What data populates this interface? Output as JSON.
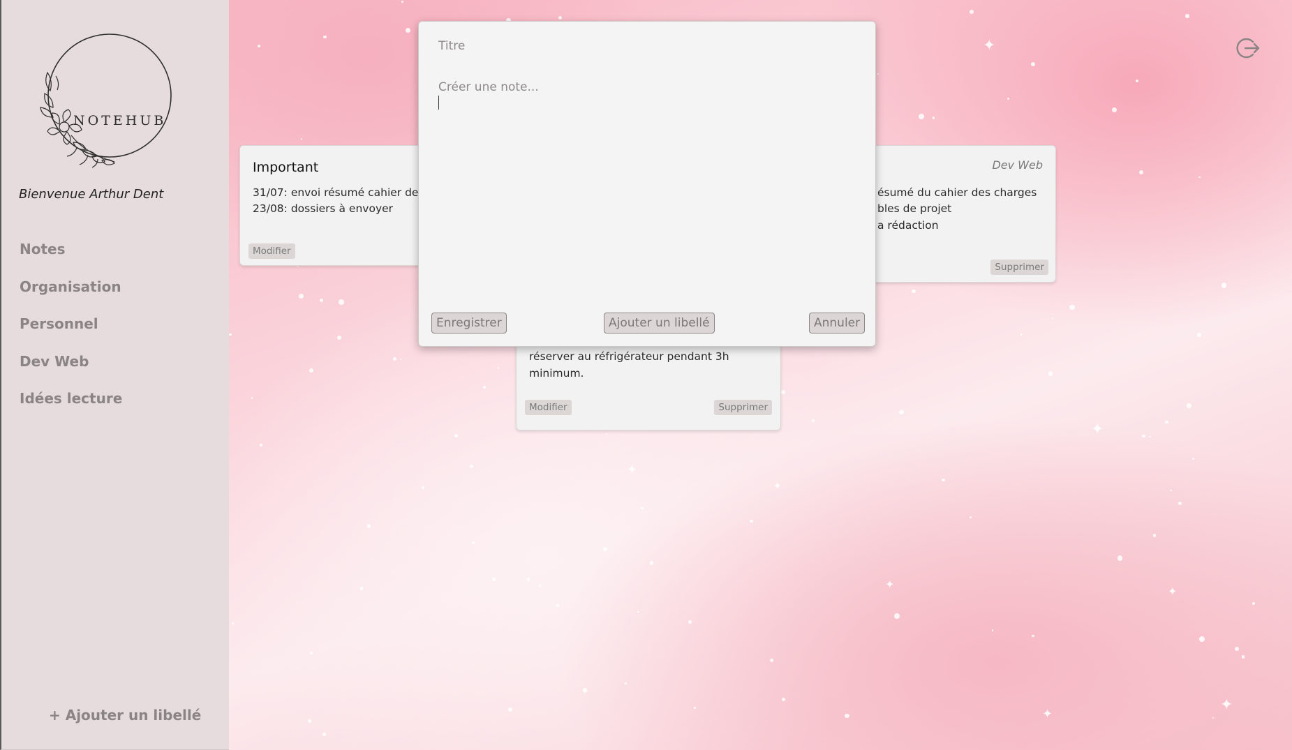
{
  "app": {
    "name": "NOTEHUB"
  },
  "sidebar": {
    "welcome": "Bienvenue Arthur Dent",
    "items": [
      {
        "label": "Notes"
      },
      {
        "label": "Organisation"
      },
      {
        "label": "Personnel"
      },
      {
        "label": "Dev Web"
      },
      {
        "label": "Idées lecture"
      }
    ],
    "add_label": "+ Ajouter un libellé"
  },
  "notes": [
    {
      "title": "Important",
      "lines": [
        "31/07: envoi résumé cahier des",
        "23/08: dossiers à envoyer"
      ],
      "modify_label": "Modifier"
    },
    {
      "label": "Dev Web",
      "lines": [
        "ésumé du cahier des charges",
        "bles de projet",
        "a rédaction"
      ],
      "delete_label": "Supprimer"
    },
    {
      "lines": [
        "réserver au réfrigérateur pendant 3h",
        "minimum."
      ],
      "modify_label": "Modifier",
      "delete_label": "Supprimer"
    }
  ],
  "editor": {
    "title_placeholder": "Titre",
    "body_placeholder": "Créer une note...",
    "save_label": "Enregistrer",
    "add_label_label": "Ajouter un libellé",
    "cancel_label": "Annuler"
  },
  "icons": {
    "logout": "logout-icon"
  },
  "colors": {
    "sidebar_bg": "#e6dcdd",
    "nav_text": "#8a8485",
    "card_bg": "#f3f2f2",
    "chip_bg": "#dcd6d7",
    "background_pink": "#f7a9b9"
  }
}
